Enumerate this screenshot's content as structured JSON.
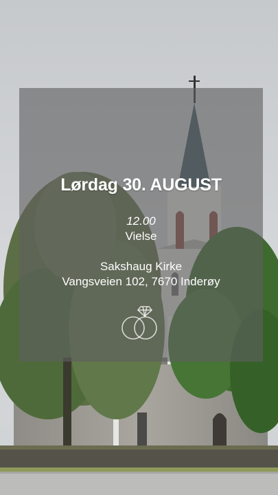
{
  "invitation": {
    "date": "Lørdag 30. AUGUST",
    "time": "12.00",
    "event": "Vielse",
    "venue": "Sakshaug Kirke",
    "address": "Vangsveien 102, 7670 Inderøy"
  },
  "icons": {
    "rings": "wedding-rings-icon"
  },
  "colors": {
    "overlay": "#5f5f5f",
    "text": "#ffffff",
    "sky": "#d3d6da"
  }
}
